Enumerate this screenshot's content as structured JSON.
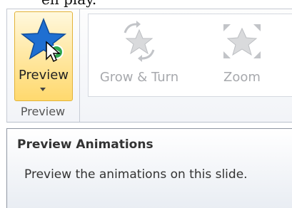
{
  "caption": "en play.",
  "ribbon": {
    "preview_button": {
      "label": "Preview",
      "icon": "preview-star-icon"
    },
    "preview_group_label": "Preview",
    "animations": [
      {
        "label": "Grow & Turn",
        "icon": "grow-turn-star-icon",
        "state": "disabled"
      },
      {
        "label": "Zoom",
        "icon": "zoom-star-icon",
        "state": "disabled"
      }
    ]
  },
  "tooltip": {
    "title": "Preview Animations",
    "body": "Preview the animations on this slide."
  },
  "colors": {
    "highlight_border": "#e3b338",
    "highlight_fill": "#ffe9a8",
    "star_blue": "#1f6fd1",
    "disabled_text": "#a7a9ad"
  }
}
